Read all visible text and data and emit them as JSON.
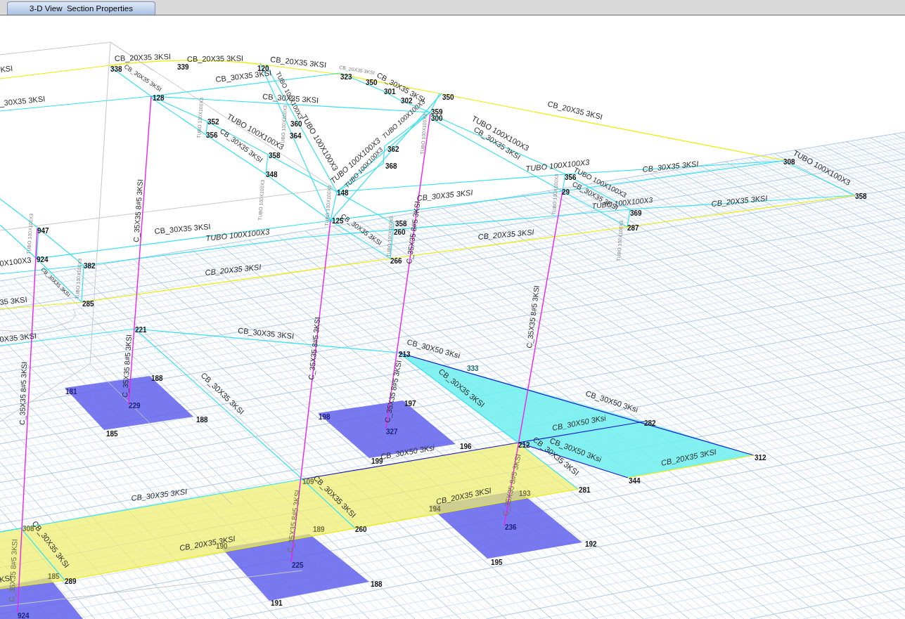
{
  "tabs": [
    {
      "label": "3-D View  Section Properties",
      "selected": true
    }
  ],
  "model_view": {
    "section_labels": [
      "KSI",
      "CB_20X35 3KSI",
      "CB_20X35 3KSI",
      "CB_20X35 3KSI",
      "CB_30X35 3KSI",
      "CB_30X35 3KSI",
      "_30X35 3KSI",
      "CB_30X35 3KSI",
      "CB_20X35 3KSI",
      "CB_30X35 3KSI",
      "TUBO 100X100X3",
      "CB_30X35 3KSI",
      "TUBO 100X100X3",
      "TUBO 100X100X3",
      "TUBO 100X100X3",
      "TUBO 100X100X3",
      "TUBO 100X100X3",
      "C_35X35 8#5 3KSI",
      "CB_30X35 3KSI",
      "TUBO 100X100X3",
      "0X100X3",
      "CB_30X35 3KSI",
      "CB_20X35 3KSI",
      "35 3KSI",
      "CB_20X35 3KSI",
      "TUBO 100X100X3",
      "CB_30X35 3KSI",
      "C_35X35 8#5 3KSI",
      "CB_30X35 3KSI",
      "CB_30X35 3KSI",
      "TUBO 100X100X3",
      "TUBO 100X100X3",
      "CB_30X35 3KSI",
      "TUBO 100X100X3",
      "CB_20X35 3KSI",
      "CB_30X35 3KSI",
      "TUBO 100X100X3",
      "CB_20X35 3KSI",
      "C_35X35 8#5 3KSI",
      "0X35 3KSI",
      "CB_30X35 3KSI",
      "C_35X35 8#5 3KSI",
      "C_35X35 8#5 3KSI",
      "C_35X35 8#5 3KSI",
      "CB_30X50 3Ksi",
      "CB_30X35 3KSI",
      "C_35X35 8#5 3KSI",
      "CB_30X35 3KSI",
      "CB_30X50 3Ksi",
      "CB_30X50 3Ksi",
      "CB_30X50 3Ksi",
      "CB_30X50 3Ksi",
      "CB_30X35 3KSI",
      "CB_20X35 3KSI",
      "C_35X35 8#5 3KSI",
      "CB_30X35 3KSI",
      "CB_20X35 3KSI",
      "CB_30X35 3KSI",
      "CB_30X35 3KSI",
      "C_35X35 8#5 3KSI",
      "KSI",
      "CB_20X35 3KSI",
      "C_35X35 8#5 3KSI",
      "TUBO 100X100X3",
      "TUBO 100X100X3",
      "TUBO 100X100X3",
      "TUBO 100X100X3",
      "TUBO 100X100X3",
      "TUBO 100X100X3",
      "TUBO 100X100X3",
      "TUBO 100X100X3",
      "TUBO 100X100X3",
      "TUBO 100X100X3"
    ],
    "joint_labels": [
      "338",
      "339",
      "120",
      "128",
      "323",
      "350",
      "301",
      "302",
      "350",
      "359",
      "300",
      "352",
      "356",
      "358",
      "348",
      "360",
      "364",
      "362",
      "368",
      "148",
      "125",
      "358",
      "260",
      "266",
      "356",
      "29",
      "308",
      "358",
      "369",
      "287",
      "947",
      "924",
      "382",
      "285",
      "221",
      "213",
      "333",
      "188",
      "181",
      "229",
      "188",
      "185",
      "197",
      "198",
      "327",
      "196",
      "199",
      "282",
      "212",
      "312",
      "344",
      "109",
      "281",
      "193",
      "194",
      "189",
      "260",
      "236",
      "192",
      "195",
      "188",
      "308",
      "185",
      "289",
      "190",
      "225",
      "191",
      "924"
    ]
  }
}
